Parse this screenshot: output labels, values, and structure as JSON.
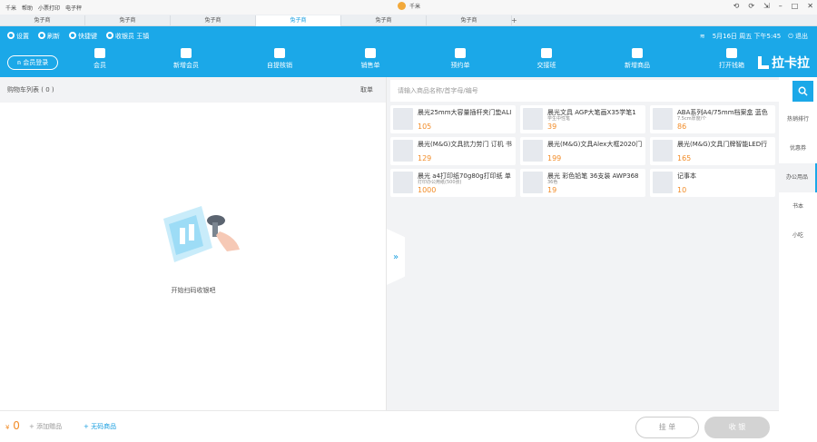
{
  "titlebar": {
    "menus": [
      "千米",
      "帮助",
      "小票打印",
      "电子秤"
    ],
    "app_title": "千米",
    "controls": [
      "⟲",
      "⟳",
      "⇲",
      "–",
      "□",
      "✕"
    ]
  },
  "tabs": [
    "兔子商",
    "兔子商",
    "兔子商",
    "兔子商",
    "兔子商",
    "兔子商"
  ],
  "topbar": {
    "settings": "设置",
    "refresh": "刷新",
    "shortcuts": "快捷键",
    "cashier": "收银员 王镇",
    "datetime": "5月16日 周五 下午5:45",
    "logout": "退出"
  },
  "login_button": "会员登录",
  "nav": [
    "会员",
    "新增会员",
    "自提核销",
    "销售单",
    "预约单",
    "交接班",
    "新增商品",
    "打开钱箱"
  ],
  "brand": "拉卡拉",
  "cart": {
    "title": "购物车列表",
    "count": "( 0 )",
    "action": "取单",
    "empty_text": "开始扫码收银吧"
  },
  "search": {
    "placeholder": "请输入商品名称/首字母/编号"
  },
  "products": [
    {
      "name": "晨光25mm大容量插杆夹门垫ALI",
      "sub": "",
      "price": "105"
    },
    {
      "name": "晨光文具 AGP大笔画X35学笔1",
      "sub": "学生中性笔",
      "price": "39"
    },
    {
      "name": "ABA系列A4/75mm档案盒 蓝色",
      "sub": "7.5cm厚度/个",
      "price": "86"
    },
    {
      "name": "晨光(M&G)文具抗力劳门 订机 书",
      "sub": "",
      "price": "129"
    },
    {
      "name": "晨光(M&G)文具Alex大框2020门",
      "sub": "",
      "price": "199"
    },
    {
      "name": "晨光(M&G)文具门牌智能LED行",
      "sub": "",
      "price": "165"
    },
    {
      "name": "晨光 a4打印纸70g80g打印纸 单",
      "sub": "打印办公用纸(500张)",
      "price": "1000"
    },
    {
      "name": "晨光 彩色铅笔 36支装 AWP368",
      "sub": "36色",
      "price": "19"
    },
    {
      "name": "记事本",
      "sub": "",
      "price": "10"
    }
  ],
  "categories": [
    "热销排行",
    "优惠券",
    "办公用品",
    "书本",
    "小吃"
  ],
  "bottom": {
    "currency": "¥",
    "total": "0",
    "add_gift": "+ 添加赠品",
    "no_code": "+ 无码商品",
    "hold": "挂 单",
    "pay": "收 银"
  }
}
